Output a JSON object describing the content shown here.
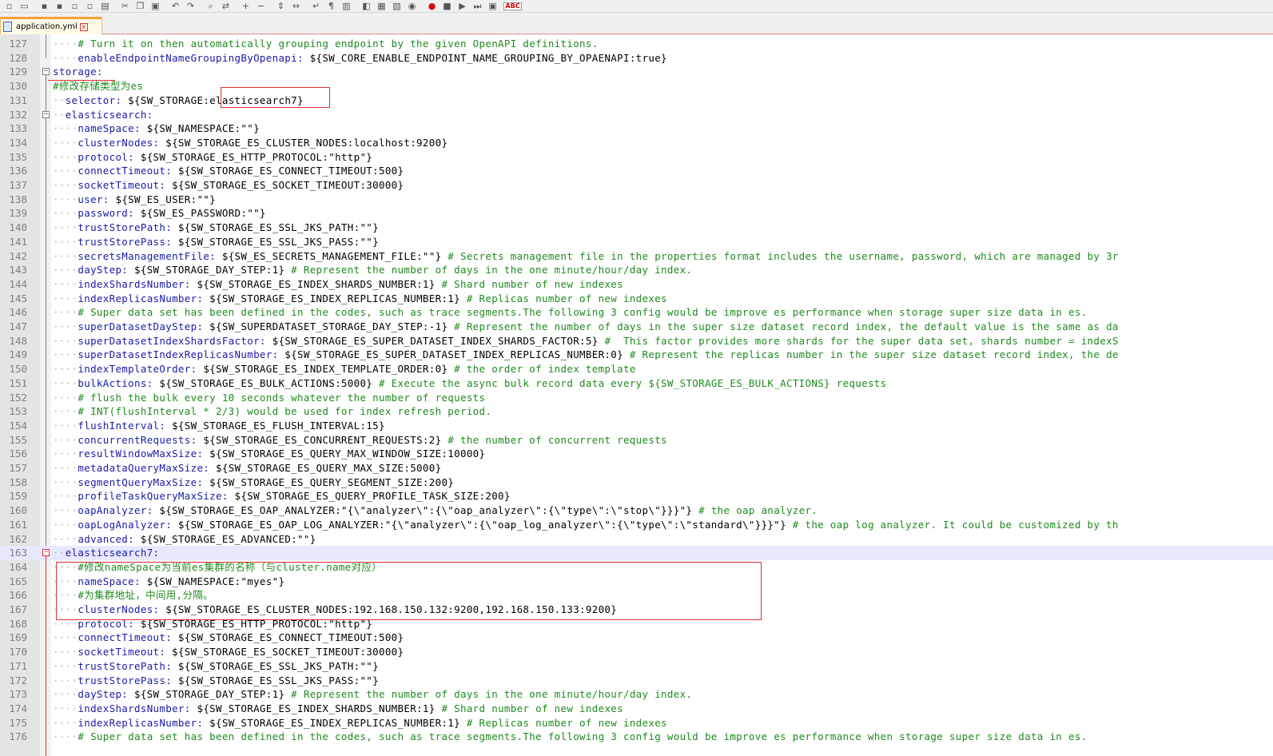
{
  "toolbar": {
    "icons": [
      "new-file-icon",
      "open-file-icon",
      "save-icon",
      "save-all-icon",
      "close-icon",
      "close-all-icon",
      "print-icon",
      "cut-icon",
      "copy-icon",
      "paste-icon",
      "undo-icon",
      "redo-icon",
      "find-icon",
      "replace-icon",
      "zoom-in-icon",
      "zoom-out-icon",
      "sync-vertical-icon",
      "sync-horizontal-icon",
      "word-wrap-icon",
      "show-all-chars-icon",
      "indent-guide-icon",
      "user-language-icon",
      "function-list-icon",
      "folder-workspace-icon",
      "monitoring-icon",
      "record-macro-icon",
      "stop-macro-icon",
      "play-macro-icon",
      "run-macro-multiple-icon",
      "save-macro-icon",
      "spell-check-icon"
    ],
    "spell_label": "ABC"
  },
  "tab": {
    "filename": "application.yml",
    "close": "x"
  },
  "editor": {
    "lines": [
      {
        "num": "127",
        "indent": 4,
        "parts": [
          {
            "t": "# Turn it on then automatically grouping endpoint by the given OpenAPI definitions.",
            "c": "c"
          }
        ]
      },
      {
        "num": "128",
        "indent": 4,
        "parts": [
          {
            "t": "enableEndpointNameGroupingByOpenapi:",
            "c": "k"
          },
          {
            "t": " ${SW_CORE_ENABLE_ENDPOINT_NAME_GROUPING_BY_OPAENAPI:true}",
            "c": "v"
          }
        ]
      },
      {
        "num": "129",
        "indent": 0,
        "parts": [
          {
            "t": "storage:",
            "c": "k"
          }
        ]
      },
      {
        "num": "130",
        "indent": 0,
        "parts": [
          {
            "t": "#修改存储类型为es",
            "c": "c"
          }
        ]
      },
      {
        "num": "131",
        "indent": 2,
        "parts": [
          {
            "t": "selector:",
            "c": "k"
          },
          {
            "t": " ${SW_STORAGE:elasticsearch7}",
            "c": "v"
          }
        ]
      },
      {
        "num": "132",
        "indent": 2,
        "parts": [
          {
            "t": "elasticsearch:",
            "c": "k"
          }
        ]
      },
      {
        "num": "133",
        "indent": 4,
        "parts": [
          {
            "t": "nameSpace:",
            "c": "k"
          },
          {
            "t": " ${SW_NAMESPACE:\"\"}",
            "c": "v"
          }
        ]
      },
      {
        "num": "134",
        "indent": 4,
        "parts": [
          {
            "t": "clusterNodes:",
            "c": "k"
          },
          {
            "t": " ${SW_STORAGE_ES_CLUSTER_NODES:localhost:9200}",
            "c": "v"
          }
        ]
      },
      {
        "num": "135",
        "indent": 4,
        "parts": [
          {
            "t": "protocol:",
            "c": "k"
          },
          {
            "t": " ${SW_STORAGE_ES_HTTP_PROTOCOL:\"http\"}",
            "c": "v"
          }
        ]
      },
      {
        "num": "136",
        "indent": 4,
        "parts": [
          {
            "t": "connectTimeout:",
            "c": "k"
          },
          {
            "t": " ${SW_STORAGE_ES_CONNECT_TIMEOUT:500}",
            "c": "v"
          }
        ]
      },
      {
        "num": "137",
        "indent": 4,
        "parts": [
          {
            "t": "socketTimeout:",
            "c": "k"
          },
          {
            "t": " ${SW_STORAGE_ES_SOCKET_TIMEOUT:30000}",
            "c": "v"
          }
        ]
      },
      {
        "num": "138",
        "indent": 4,
        "parts": [
          {
            "t": "user:",
            "c": "k"
          },
          {
            "t": " ${SW_ES_USER:\"\"}",
            "c": "v"
          }
        ]
      },
      {
        "num": "139",
        "indent": 4,
        "parts": [
          {
            "t": "password:",
            "c": "k"
          },
          {
            "t": " ${SW_ES_PASSWORD:\"\"}",
            "c": "v"
          }
        ]
      },
      {
        "num": "140",
        "indent": 4,
        "parts": [
          {
            "t": "trustStorePath:",
            "c": "k"
          },
          {
            "t": " ${SW_STORAGE_ES_SSL_JKS_PATH:\"\"}",
            "c": "v"
          }
        ]
      },
      {
        "num": "141",
        "indent": 4,
        "parts": [
          {
            "t": "trustStorePass:",
            "c": "k"
          },
          {
            "t": " ${SW_STORAGE_ES_SSL_JKS_PASS:\"\"}",
            "c": "v"
          }
        ]
      },
      {
        "num": "142",
        "indent": 4,
        "parts": [
          {
            "t": "secretsManagementFile:",
            "c": "k"
          },
          {
            "t": " ${SW_ES_SECRETS_MANAGEMENT_FILE:\"\"}",
            "c": "v"
          },
          {
            "t": " # Secrets management file in the properties format includes the username, password, which are managed by 3r",
            "c": "c"
          }
        ]
      },
      {
        "num": "143",
        "indent": 4,
        "parts": [
          {
            "t": "dayStep:",
            "c": "k"
          },
          {
            "t": " ${SW_STORAGE_DAY_STEP:1}",
            "c": "v"
          },
          {
            "t": " # Represent the number of days in the one minute/hour/day index.",
            "c": "c"
          }
        ]
      },
      {
        "num": "144",
        "indent": 4,
        "parts": [
          {
            "t": "indexShardsNumber:",
            "c": "k"
          },
          {
            "t": " ${SW_STORAGE_ES_INDEX_SHARDS_NUMBER:1}",
            "c": "v"
          },
          {
            "t": " # Shard number of new indexes",
            "c": "c"
          }
        ]
      },
      {
        "num": "145",
        "indent": 4,
        "parts": [
          {
            "t": "indexReplicasNumber:",
            "c": "k"
          },
          {
            "t": " ${SW_STORAGE_ES_INDEX_REPLICAS_NUMBER:1}",
            "c": "v"
          },
          {
            "t": " # Replicas number of new indexes",
            "c": "c"
          }
        ]
      },
      {
        "num": "146",
        "indent": 4,
        "parts": [
          {
            "t": "# Super data set has been defined in the codes, such as trace segments.The following 3 config would be improve es performance when storage super size data in es.",
            "c": "c"
          }
        ]
      },
      {
        "num": "147",
        "indent": 4,
        "parts": [
          {
            "t": "superDatasetDayStep:",
            "c": "k"
          },
          {
            "t": " ${SW_SUPERDATASET_STORAGE_DAY_STEP:-1}",
            "c": "v"
          },
          {
            "t": " # Represent the number of days in the super size dataset record index, the default value is the same as da",
            "c": "c"
          }
        ]
      },
      {
        "num": "148",
        "indent": 4,
        "parts": [
          {
            "t": "superDatasetIndexShardsFactor:",
            "c": "k"
          },
          {
            "t": " ${SW_STORAGE_ES_SUPER_DATASET_INDEX_SHARDS_FACTOR:5}",
            "c": "v"
          },
          {
            "t": " #  This factor provides more shards for the super data set, shards number = indexS",
            "c": "c"
          }
        ]
      },
      {
        "num": "149",
        "indent": 4,
        "parts": [
          {
            "t": "superDatasetIndexReplicasNumber:",
            "c": "k"
          },
          {
            "t": " ${SW_STORAGE_ES_SUPER_DATASET_INDEX_REPLICAS_NUMBER:0}",
            "c": "v"
          },
          {
            "t": " # Represent the replicas number in the super size dataset record index, the de",
            "c": "c"
          }
        ]
      },
      {
        "num": "150",
        "indent": 4,
        "parts": [
          {
            "t": "indexTemplateOrder:",
            "c": "k"
          },
          {
            "t": " ${SW_STORAGE_ES_INDEX_TEMPLATE_ORDER:0}",
            "c": "v"
          },
          {
            "t": " # the order of index template",
            "c": "c"
          }
        ]
      },
      {
        "num": "151",
        "indent": 4,
        "parts": [
          {
            "t": "bulkActions:",
            "c": "k"
          },
          {
            "t": " ${SW_STORAGE_ES_BULK_ACTIONS:5000}",
            "c": "v"
          },
          {
            "t": " # Execute the async bulk record data every ${SW_STORAGE_ES_BULK_ACTIONS} requests",
            "c": "c"
          }
        ]
      },
      {
        "num": "152",
        "indent": 4,
        "parts": [
          {
            "t": "# flush the bulk every 10 seconds whatever the number of requests",
            "c": "c"
          }
        ]
      },
      {
        "num": "153",
        "indent": 4,
        "parts": [
          {
            "t": "# INT(flushInterval * 2/3) would be used for index refresh period.",
            "c": "c"
          }
        ]
      },
      {
        "num": "154",
        "indent": 4,
        "parts": [
          {
            "t": "flushInterval:",
            "c": "k"
          },
          {
            "t": " ${SW_STORAGE_ES_FLUSH_INTERVAL:15}",
            "c": "v"
          }
        ]
      },
      {
        "num": "155",
        "indent": 4,
        "parts": [
          {
            "t": "concurrentRequests:",
            "c": "k"
          },
          {
            "t": " ${SW_STORAGE_ES_CONCURRENT_REQUESTS:2}",
            "c": "v"
          },
          {
            "t": " # the number of concurrent requests",
            "c": "c"
          }
        ]
      },
      {
        "num": "156",
        "indent": 4,
        "parts": [
          {
            "t": "resultWindowMaxSize:",
            "c": "k"
          },
          {
            "t": " ${SW_STORAGE_ES_QUERY_MAX_WINDOW_SIZE:10000}",
            "c": "v"
          }
        ]
      },
      {
        "num": "157",
        "indent": 4,
        "parts": [
          {
            "t": "metadataQueryMaxSize:",
            "c": "k"
          },
          {
            "t": " ${SW_STORAGE_ES_QUERY_MAX_SIZE:5000}",
            "c": "v"
          }
        ]
      },
      {
        "num": "158",
        "indent": 4,
        "parts": [
          {
            "t": "segmentQueryMaxSize:",
            "c": "k"
          },
          {
            "t": " ${SW_STORAGE_ES_QUERY_SEGMENT_SIZE:200}",
            "c": "v"
          }
        ]
      },
      {
        "num": "159",
        "indent": 4,
        "parts": [
          {
            "t": "profileTaskQueryMaxSize:",
            "c": "k"
          },
          {
            "t": " ${SW_STORAGE_ES_QUERY_PROFILE_TASK_SIZE:200}",
            "c": "v"
          }
        ]
      },
      {
        "num": "160",
        "indent": 4,
        "parts": [
          {
            "t": "oapAnalyzer:",
            "c": "k"
          },
          {
            "t": " ${SW_STORAGE_ES_OAP_ANALYZER:\"{\\\"analyzer\\\":{\\\"oap_analyzer\\\":{\\\"type\\\":\\\"stop\\\"}}}\"}",
            "c": "v"
          },
          {
            "t": " # the oap analyzer.",
            "c": "c"
          }
        ]
      },
      {
        "num": "161",
        "indent": 4,
        "parts": [
          {
            "t": "oapLogAnalyzer:",
            "c": "k"
          },
          {
            "t": " ${SW_STORAGE_ES_OAP_LOG_ANALYZER:\"{\\\"analyzer\\\":{\\\"oap_log_analyzer\\\":{\\\"type\\\":\\\"standard\\\"}}}\"}",
            "c": "v"
          },
          {
            "t": " # the oap log analyzer. It could be customized by th",
            "c": "c"
          }
        ]
      },
      {
        "num": "162",
        "indent": 4,
        "parts": [
          {
            "t": "advanced:",
            "c": "k"
          },
          {
            "t": " ${SW_STORAGE_ES_ADVANCED:\"\"}",
            "c": "v"
          }
        ]
      },
      {
        "num": "163",
        "indent": 2,
        "parts": [
          {
            "t": "elasticsearch7:",
            "c": "k"
          }
        ]
      },
      {
        "num": "164",
        "indent": 4,
        "parts": [
          {
            "t": "#修改nameSpace为当前es集群的名称（与cluster.name对应）",
            "c": "c"
          }
        ]
      },
      {
        "num": "165",
        "indent": 4,
        "parts": [
          {
            "t": "nameSpace:",
            "c": "k"
          },
          {
            "t": " ${SW_NAMESPACE:\"myes\"}",
            "c": "v"
          }
        ]
      },
      {
        "num": "166",
        "indent": 4,
        "parts": [
          {
            "t": "#为集群地址，中间用,分隔。",
            "c": "c"
          }
        ]
      },
      {
        "num": "167",
        "indent": 4,
        "parts": [
          {
            "t": "clusterNodes:",
            "c": "k"
          },
          {
            "t": " ${SW_STORAGE_ES_CLUSTER_NODES:192.168.150.132:9200,192.168.150.133:9200}",
            "c": "v"
          }
        ]
      },
      {
        "num": "168",
        "indent": 4,
        "parts": [
          {
            "t": "protocol:",
            "c": "k"
          },
          {
            "t": " ${SW_STORAGE_ES_HTTP_PROTOCOL:\"http\"}",
            "c": "v"
          }
        ]
      },
      {
        "num": "169",
        "indent": 4,
        "parts": [
          {
            "t": "connectTimeout:",
            "c": "k"
          },
          {
            "t": " ${SW_STORAGE_ES_CONNECT_TIMEOUT:500}",
            "c": "v"
          }
        ]
      },
      {
        "num": "170",
        "indent": 4,
        "parts": [
          {
            "t": "socketTimeout:",
            "c": "k"
          },
          {
            "t": " ${SW_STORAGE_ES_SOCKET_TIMEOUT:30000}",
            "c": "v"
          }
        ]
      },
      {
        "num": "171",
        "indent": 4,
        "parts": [
          {
            "t": "trustStorePath:",
            "c": "k"
          },
          {
            "t": " ${SW_STORAGE_ES_SSL_JKS_PATH:\"\"}",
            "c": "v"
          }
        ]
      },
      {
        "num": "172",
        "indent": 4,
        "parts": [
          {
            "t": "trustStorePass:",
            "c": "k"
          },
          {
            "t": " ${SW_STORAGE_ES_SSL_JKS_PASS:\"\"}",
            "c": "v"
          }
        ]
      },
      {
        "num": "173",
        "indent": 4,
        "parts": [
          {
            "t": "dayStep:",
            "c": "k"
          },
          {
            "t": " ${SW_STORAGE_DAY_STEP:1}",
            "c": "v"
          },
          {
            "t": " # Represent the number of days in the one minute/hour/day index.",
            "c": "c"
          }
        ]
      },
      {
        "num": "174",
        "indent": 4,
        "parts": [
          {
            "t": "indexShardsNumber:",
            "c": "k"
          },
          {
            "t": " ${SW_STORAGE_ES_INDEX_SHARDS_NUMBER:1}",
            "c": "v"
          },
          {
            "t": " # Shard number of new indexes",
            "c": "c"
          }
        ]
      },
      {
        "num": "175",
        "indent": 4,
        "parts": [
          {
            "t": "indexReplicasNumber:",
            "c": "k"
          },
          {
            "t": " ${SW_STORAGE_ES_INDEX_REPLICAS_NUMBER:1}",
            "c": "v"
          },
          {
            "t": " # Replicas number of new indexes",
            "c": "c"
          }
        ]
      },
      {
        "num": "176",
        "indent": 4,
        "parts": [
          {
            "t": "# Super data set has been defined in the codes, such as trace segments.The following 3 config would be improve es performance when storage super size data in es.",
            "c": "c"
          }
        ]
      }
    ]
  },
  "colors": {
    "key": "#1a1aa6",
    "comment": "#1f8a1f",
    "value": "#000000",
    "whitespace": "#b4b4b4",
    "highlight_box": "#e03030",
    "active_line": "#e8e8ff"
  }
}
